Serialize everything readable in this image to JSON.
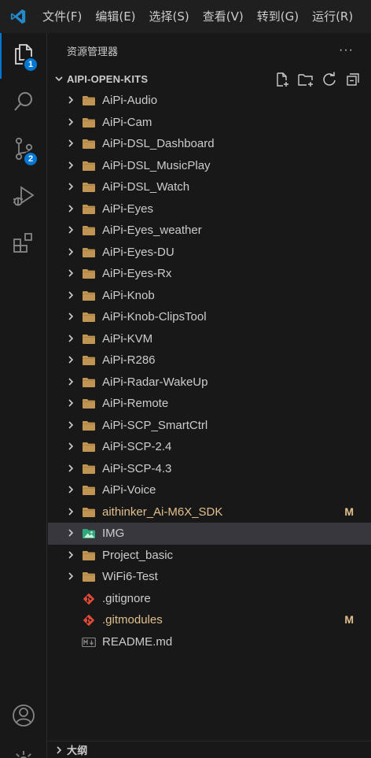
{
  "menu": [
    "文件(F)",
    "编辑(E)",
    "选择(S)",
    "查看(V)",
    "转到(G)",
    "运行(R)"
  ],
  "activity": {
    "explorer_badge": "1",
    "scm_badge": "2"
  },
  "sidebar": {
    "title": "资源管理器",
    "more": "···",
    "section_title": "AIPI-OPEN-KITS",
    "outline_title": "大纲"
  },
  "tree": [
    {
      "label": "AiPi-Audio",
      "type": "folder",
      "status": ""
    },
    {
      "label": "AiPi-Cam",
      "type": "folder",
      "status": ""
    },
    {
      "label": "AiPi-DSL_Dashboard",
      "type": "folder",
      "status": ""
    },
    {
      "label": "AiPi-DSL_MusicPlay",
      "type": "folder",
      "status": ""
    },
    {
      "label": "AiPi-DSL_Watch",
      "type": "folder",
      "status": ""
    },
    {
      "label": "AiPi-Eyes",
      "type": "folder",
      "status": ""
    },
    {
      "label": "AiPi-Eyes_weather",
      "type": "folder",
      "status": ""
    },
    {
      "label": "AiPi-Eyes-DU",
      "type": "folder",
      "status": ""
    },
    {
      "label": "AiPi-Eyes-Rx",
      "type": "folder",
      "status": ""
    },
    {
      "label": "AiPi-Knob",
      "type": "folder",
      "status": ""
    },
    {
      "label": "AiPi-Knob-ClipsTool",
      "type": "folder",
      "status": ""
    },
    {
      "label": "AiPi-KVM",
      "type": "folder",
      "status": ""
    },
    {
      "label": "AiPi-R286",
      "type": "folder",
      "status": ""
    },
    {
      "label": "AiPi-Radar-WakeUp",
      "type": "folder",
      "status": ""
    },
    {
      "label": "AiPi-Remote",
      "type": "folder",
      "status": ""
    },
    {
      "label": "AiPi-SCP_SmartCtrl",
      "type": "folder",
      "status": ""
    },
    {
      "label": "AiPi-SCP-2.4",
      "type": "folder",
      "status": ""
    },
    {
      "label": "AiPi-SCP-4.3",
      "type": "folder",
      "status": ""
    },
    {
      "label": "AiPi-Voice",
      "type": "folder",
      "status": ""
    },
    {
      "label": "aithinker_Ai-M6X_SDK",
      "type": "folder",
      "status": "M"
    },
    {
      "label": "IMG",
      "type": "image-folder",
      "status": ""
    },
    {
      "label": "Project_basic",
      "type": "folder",
      "status": ""
    },
    {
      "label": "WiFi6-Test",
      "type": "folder",
      "status": ""
    },
    {
      "label": ".gitignore",
      "type": "git-file",
      "status": ""
    },
    {
      "label": ".gitmodules",
      "type": "git-file",
      "status": "M"
    },
    {
      "label": "README.md",
      "type": "markdown-file",
      "status": ""
    }
  ],
  "colors": {
    "accent": "#0078d4",
    "folder": "#c09553",
    "modified": "#e2c08d",
    "git": "#e44b37",
    "selected": "#37373d"
  }
}
